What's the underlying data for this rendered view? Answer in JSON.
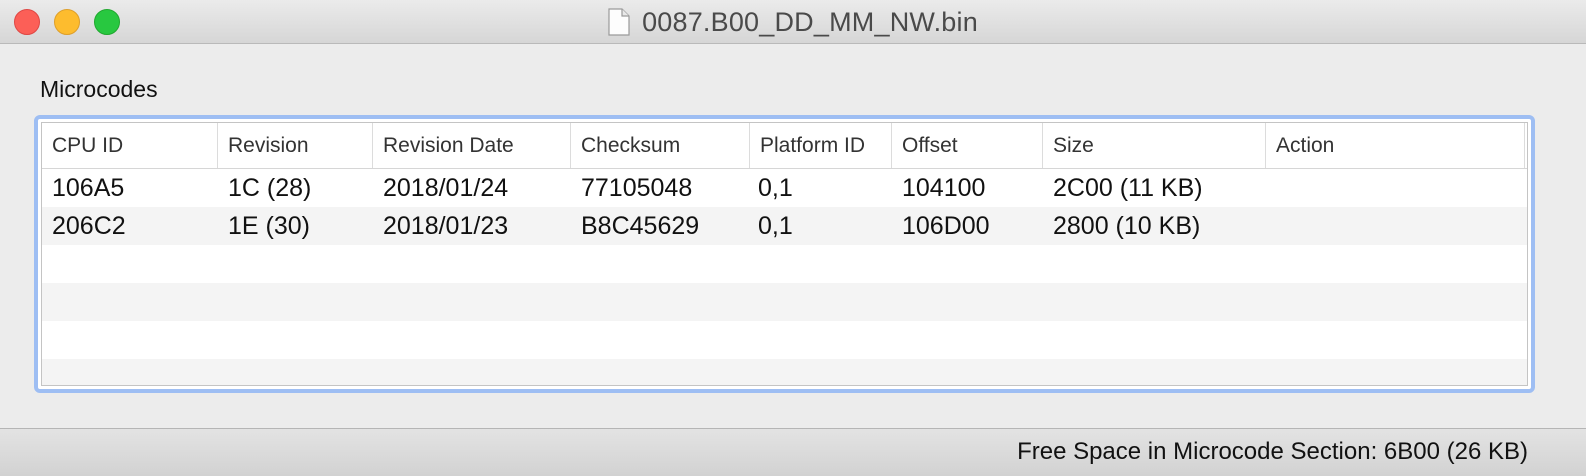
{
  "window": {
    "title": "0087.B00_DD_MM_NW.bin",
    "file_icon": "document-icon"
  },
  "section_label": "Microcodes",
  "table": {
    "columns": [
      "CPU ID",
      "Revision",
      "Revision Date",
      "Checksum",
      "Platform ID",
      "Offset",
      "Size",
      "Action"
    ],
    "rows": [
      [
        "106A5",
        "1C (28)",
        "2018/01/24",
        "77105048",
        "0,1",
        "104100",
        "2C00 (11 KB)",
        ""
      ],
      [
        "206C2",
        "1E (30)",
        "2018/01/23",
        "B8C45629",
        "0,1",
        "106D00",
        "2800 (10 KB)",
        ""
      ]
    ]
  },
  "status": {
    "free_space": "Free Space in Microcode Section: 6B00 (26 KB)"
  }
}
